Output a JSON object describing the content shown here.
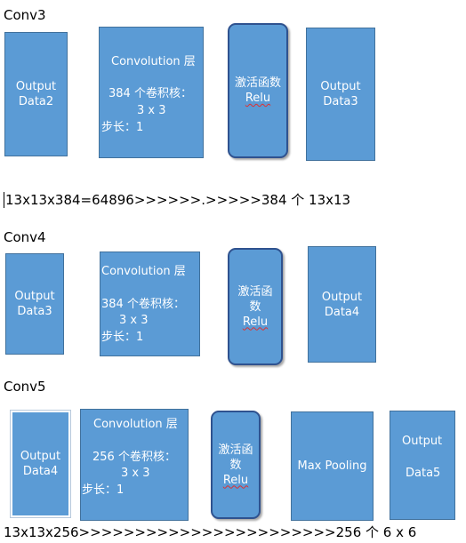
{
  "conv3": {
    "label": "Conv3",
    "input": [
      "Output",
      "Data2"
    ],
    "conv": {
      "title": "Convolution 层",
      "kernels": "384 个卷积核：",
      "size": "3 x 3",
      "stride": "步长：1"
    },
    "relu": [
      "激活函数",
      "Relu"
    ],
    "output": [
      "Output",
      "Data3"
    ],
    "calc": "13x13x384=64896>>>>>>.>>>>>384 个 13x13"
  },
  "conv4": {
    "label": "Conv4",
    "input": [
      "Output",
      "Data3"
    ],
    "conv": {
      "title": "Convolution 层",
      "kernels": "384 个卷积核：",
      "size": "3 x 3",
      "stride": "步长：1"
    },
    "relu": [
      "激活函",
      "数",
      "Relu"
    ],
    "output": [
      "Output",
      "Data4"
    ]
  },
  "conv5": {
    "label": "Conv5",
    "input": [
      "Output",
      "Data4"
    ],
    "conv": {
      "title": "Convolution 层",
      "kernels": "256 个卷积核：",
      "size": "3 x 3",
      "stride": "步长：1"
    },
    "relu": [
      "激活函",
      "数",
      "Relu"
    ],
    "pool": "Max Pooling",
    "output": [
      "Output",
      "Data5"
    ],
    "calc": "13x13x256>>>>>>>>>>>>>>>>>>>>>>>256 个 6 x 6"
  },
  "colors": {
    "box_fill": "#5b9bd5",
    "box_border": "#41719c",
    "relu_border": "#2f528f",
    "text_on_box": "#ffffff"
  }
}
